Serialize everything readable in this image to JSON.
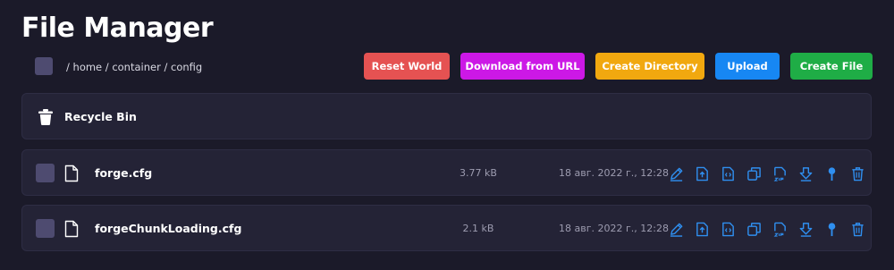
{
  "page": {
    "title": "File Manager"
  },
  "breadcrumb": {
    "parts": [
      "/ home",
      "/ container",
      "/ config"
    ]
  },
  "toolbar": {
    "reset_world": "Reset World",
    "download_from_url": "Download from URL",
    "create_directory": "Create Directory",
    "upload": "Upload",
    "create_file": "Create File"
  },
  "recycle_bin": {
    "label": "Recycle Bin",
    "icon": "trash-icon"
  },
  "files": [
    {
      "name": "forge.cfg",
      "size": "3.77 kB",
      "modified": "18 авг. 2022 г., 12:28"
    },
    {
      "name": "forgeChunkLoading.cfg",
      "size": "2.1 kB",
      "modified": "18 авг. 2022 г., 12:28"
    }
  ],
  "row_actions": [
    "edit-icon",
    "upload-file-icon",
    "code-file-icon",
    "copy-icon",
    "zip-icon",
    "download-icon",
    "pin-icon",
    "delete-icon"
  ],
  "colors": {
    "background": "#1b1a29",
    "row": "#242336",
    "checkbox": "#4e4b70",
    "reset": "#e55252",
    "download": "#cc18e6",
    "create_directory": "#f1a80f",
    "upload": "#1787f3",
    "create_file": "#1fad46",
    "action_icon": "#2f8ff0"
  }
}
